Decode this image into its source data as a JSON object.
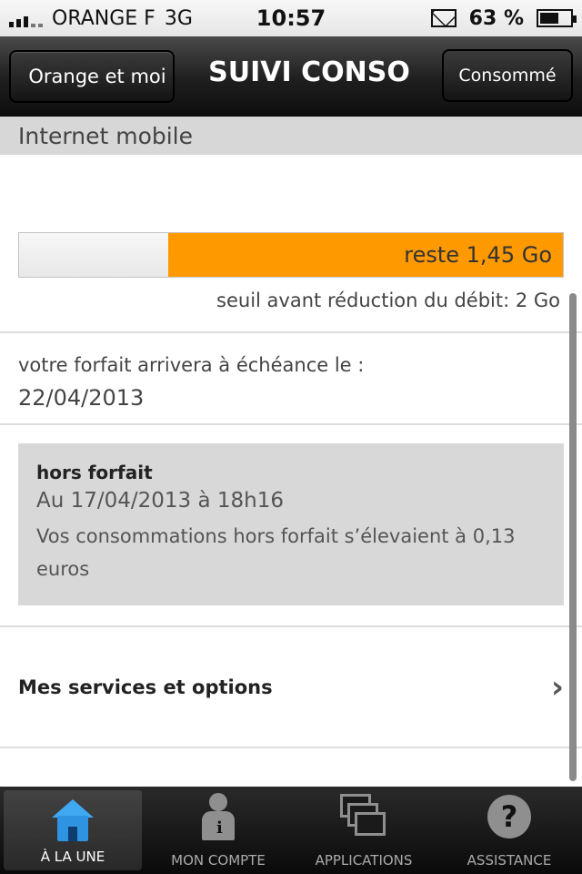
{
  "status_bar": {
    "carrier": "ORANGE F",
    "network": "3G",
    "time": "10:57",
    "battery": "63 %",
    "icons": [
      "signal-icon",
      "mail-icon",
      "battery-charging-icon"
    ]
  },
  "nav": {
    "back_label": "Orange et moi",
    "title": "suivi conso",
    "right_label": "Consommé"
  },
  "section": {
    "title": "Internet mobile"
  },
  "usage": {
    "remaining_label": "reste 1,45 Go",
    "remaining_fraction": 0.725,
    "bar_color": "#ff9900",
    "threshold": "seuil avant réduction du débit: 2 Go"
  },
  "expiry": {
    "label": "votre forfait arrivera à échéance le :",
    "date": "22/04/2013"
  },
  "hors_forfait": {
    "title": "hors forfait",
    "date": "Au 17/04/2013 à 18h16",
    "text": "Vos consommations hors forfait s’élevaient à 0,13 euros"
  },
  "services": {
    "label": "Mes services et options"
  },
  "tabs": [
    {
      "label": "à la une",
      "icon": "home-icon",
      "active": true
    },
    {
      "label": "mon compte",
      "icon": "account-icon",
      "active": false
    },
    {
      "label": "applications",
      "icon": "applications-icon",
      "active": false
    },
    {
      "label": "assistance",
      "icon": "help-icon",
      "active": false
    }
  ]
}
